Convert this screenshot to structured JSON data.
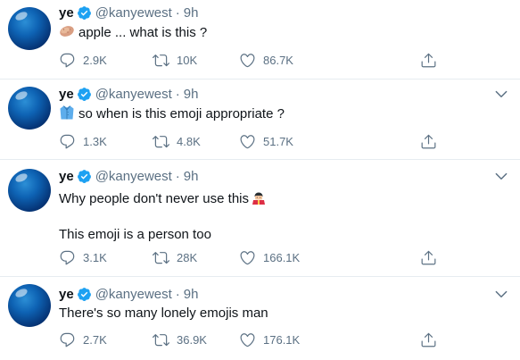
{
  "tweets": [
    {
      "name": "ye",
      "handle": "@kanyewest",
      "separator": "·",
      "time": "9h",
      "emoji_icon": "potato-emoji",
      "lines": [
        "apple ... what is this ?"
      ],
      "replies": "2.9K",
      "retweets": "10K",
      "likes": "86.7K",
      "show_caret": false
    },
    {
      "name": "ye",
      "handle": "@kanyewest",
      "separator": "·",
      "time": "9h",
      "emoji_icon": "coat-emoji",
      "lines": [
        "so when is this emoji appropriate ?"
      ],
      "replies": "1.3K",
      "retweets": "4.8K",
      "likes": "51.7K",
      "show_caret": true
    },
    {
      "name": "ye",
      "handle": "@kanyewest",
      "separator": "·",
      "time": "9h",
      "emoji_icon": "guard-emoji",
      "lines": [
        "Why people don't never use this",
        "This emoji is a person too"
      ],
      "replies": "3.1K",
      "retweets": "28K",
      "likes": "166.1K",
      "show_caret": true
    },
    {
      "name": "ye",
      "handle": "@kanyewest",
      "separator": "·",
      "time": "9h",
      "lines": [
        "There's so many lonely emojis man"
      ],
      "replies": "2.7K",
      "retweets": "36.9K",
      "likes": "176.1K",
      "show_caret": true
    }
  ],
  "colors": {
    "verified_blue": "#1da1f2",
    "secondary_text": "#5b7083",
    "divider": "#e6ecf0"
  }
}
